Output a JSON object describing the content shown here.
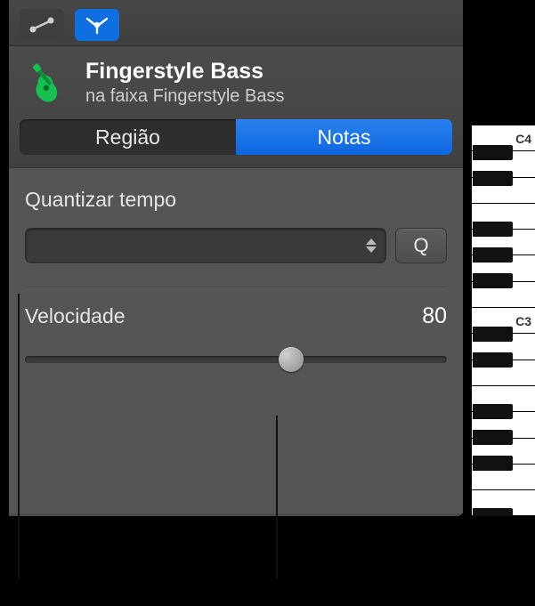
{
  "toolbar": {
    "mode_automation": "automation-mode",
    "mode_midi": "midi-mode"
  },
  "header": {
    "title": "Fingerstyle Bass",
    "subtitle": "na faixa Fingerstyle Bass"
  },
  "segmented": {
    "region": "Região",
    "notes": "Notas",
    "active": "notes"
  },
  "quantize": {
    "label": "Quantizar tempo",
    "value": "",
    "button": "Q"
  },
  "velocity": {
    "label": "Velocidade",
    "value": "80",
    "min": 0,
    "max": 127
  },
  "piano": {
    "labels": {
      "c4": "C4",
      "c3": "C3"
    }
  }
}
